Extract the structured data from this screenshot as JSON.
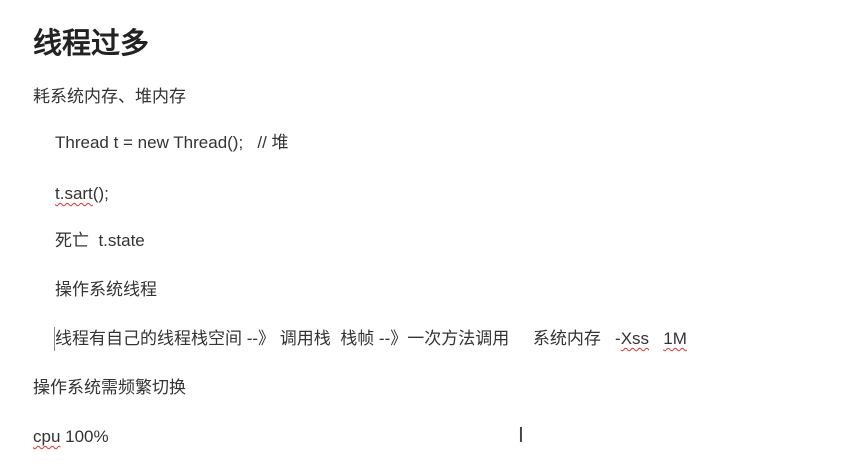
{
  "heading": "线程过多",
  "lines": [
    {
      "text": "耗系统内存、堆内存"
    },
    {
      "text": "Thread t = new Thread();   // 堆"
    },
    {
      "squiggle": "t.sart",
      "rest": "();"
    },
    {
      "text": "死亡  t.state"
    },
    {
      "text": "操作系统线程"
    },
    {
      "text": "线程有自己的线程栈空间 --》 调用栈  栈帧 --》一次方法调用     系统内存   -",
      "sq1": "Xss",
      "mid": "   ",
      "sq2": "1M"
    },
    {
      "text": "操作系统需频繁切换"
    },
    {
      "squiggle": "cpu",
      "rest": " 100%"
    }
  ],
  "colors": {
    "spellcheck": "#e03030",
    "text": "#333333"
  }
}
